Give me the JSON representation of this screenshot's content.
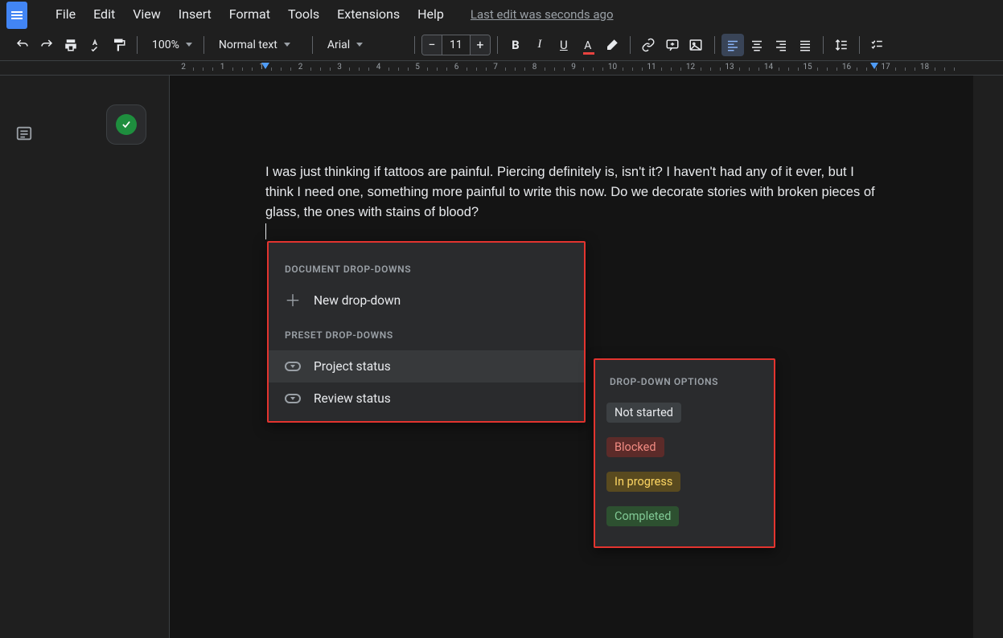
{
  "menubar": {
    "items": [
      "File",
      "Edit",
      "View",
      "Insert",
      "Format",
      "Tools",
      "Extensions",
      "Help"
    ],
    "last_edit": "Last edit was seconds ago"
  },
  "toolbar": {
    "zoom": "100%",
    "style": "Normal text",
    "font": "Arial",
    "font_size": "11"
  },
  "ruler": {
    "labels": [
      "2",
      "1",
      "1",
      "2",
      "3",
      "4",
      "5",
      "6",
      "7",
      "8",
      "9",
      "10",
      "11",
      "12",
      "13",
      "14",
      "15",
      "16",
      "17",
      "18"
    ]
  },
  "document": {
    "body": "I was just thinking if tattoos are painful. Piercing definitely is, isn't it? I haven't had any of it ever, but I think I need one, something more painful to write this now. Do we decorate stories with broken pieces of glass, the ones with stains of blood?"
  },
  "dropdown_panel": {
    "section1": "DOCUMENT DROP-DOWNS",
    "new_label": "New drop-down",
    "section2": "PRESET DROP-DOWNS",
    "presets": [
      "Project status",
      "Review status"
    ]
  },
  "options_panel": {
    "header": "DROP-DOWN OPTIONS",
    "options": [
      {
        "label": "Not started",
        "bg": "#3c4043",
        "fg": "#e8eaed"
      },
      {
        "label": "Blocked",
        "bg": "#5c2b29",
        "fg": "#f28b82"
      },
      {
        "label": "In progress",
        "bg": "#594a1f",
        "fg": "#fdd663"
      },
      {
        "label": "Completed",
        "bg": "#2d5030",
        "fg": "#81c995"
      }
    ]
  }
}
